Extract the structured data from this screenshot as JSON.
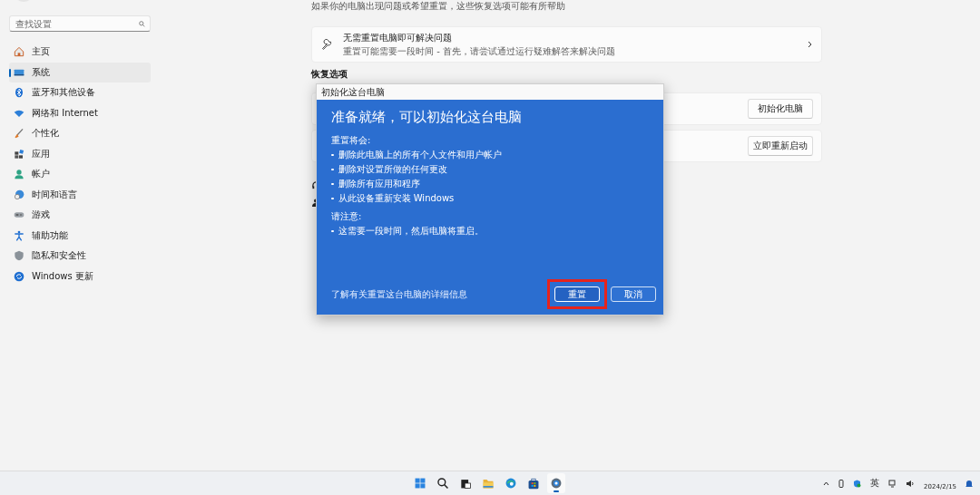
{
  "sidebar": {
    "search": {
      "placeholder": "查找设置"
    },
    "items": [
      {
        "label": "主页",
        "selected": false
      },
      {
        "label": "系统",
        "selected": true
      },
      {
        "label": "蓝牙和其他设备",
        "selected": false
      },
      {
        "label": "网络和 Internet",
        "selected": false
      },
      {
        "label": "个性化",
        "selected": false
      },
      {
        "label": "应用",
        "selected": false
      },
      {
        "label": "帐户",
        "selected": false
      },
      {
        "label": "时间和语言",
        "selected": false
      },
      {
        "label": "游戏",
        "selected": false
      },
      {
        "label": "辅助功能",
        "selected": false
      },
      {
        "label": "隐私和安全性",
        "selected": false
      },
      {
        "label": "Windows 更新",
        "selected": false
      }
    ]
  },
  "main": {
    "intro": "如果你的电脑出现问题或希望重置，这些恢复选项可能有所帮助",
    "fix_card": {
      "title": "无需重置电脑即可解决问题",
      "subtitle": "重置可能需要一段时间 - 首先，请尝试通过运行疑难解答来解决问题"
    },
    "section_title": "恢复选项",
    "option_buttons": [
      "初始化电脑",
      "立即重新启动"
    ]
  },
  "dialog": {
    "title": "初始化这台电脑",
    "heading": "准备就绪，可以初始化这台电脑",
    "groups": [
      {
        "label": "重置将会:",
        "items": [
          "删除此电脑上的所有个人文件和用户帐户",
          "删除对设置所做的任何更改",
          "删除所有应用和程序",
          "从此设备重新安装 Windows"
        ]
      },
      {
        "label": "请注意:",
        "items": [
          "这需要一段时间，然后电脑将重启。"
        ]
      }
    ],
    "link": "了解有关重置这台电脑的详细信息",
    "buttons": [
      {
        "label": "重置",
        "primary": true,
        "highlighted": true
      },
      {
        "label": "取消",
        "primary": false,
        "highlighted": false
      }
    ]
  },
  "taskbar": {
    "apps": [
      {
        "kind": "start",
        "selected": false
      },
      {
        "kind": "search",
        "selected": false
      },
      {
        "kind": "taskview",
        "selected": false
      },
      {
        "kind": "folder",
        "selected": false
      },
      {
        "kind": "browser",
        "selected": false
      },
      {
        "kind": "store",
        "selected": false
      },
      {
        "kind": "settings",
        "selected": true
      }
    ],
    "input_language": "英",
    "date": "2024/2/15"
  }
}
